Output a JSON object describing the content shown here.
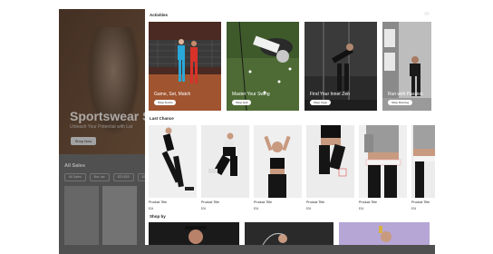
{
  "background_page": {
    "hero_title": "Sportswear S",
    "hero_subtitle": "Unleash Your Potential with Lat",
    "shop_now_label": "Shop Now",
    "all_sales_label": "All Sales",
    "filters": [
      "All Sales",
      "Bra, tax",
      "$20-$35",
      "$35-$50",
      "$50-..."
    ]
  },
  "drawer": {
    "activities_title": "Activities",
    "activities": [
      {
        "label": "Game, Set, Match",
        "button": "Shop Tennis"
      },
      {
        "label": "Master Your Swing",
        "button": "Shop Golf"
      },
      {
        "label": "Find Your Inner Zen",
        "button": "Shop Yoga"
      },
      {
        "label": "Run with Passion",
        "button": "Shop Running"
      }
    ],
    "last_chance_title": "Last Chance",
    "products": [
      {
        "title": "Product Title",
        "price": "$34"
      },
      {
        "title": "Product Title",
        "price": "$34"
      },
      {
        "title": "Product Title",
        "price": "$34"
      },
      {
        "title": "Product Title",
        "price": "$34"
      },
      {
        "title": "Product Title",
        "price": "$34"
      },
      {
        "title": "Product Title",
        "price": "$34"
      }
    ],
    "shop_by_title": "Shop by"
  }
}
